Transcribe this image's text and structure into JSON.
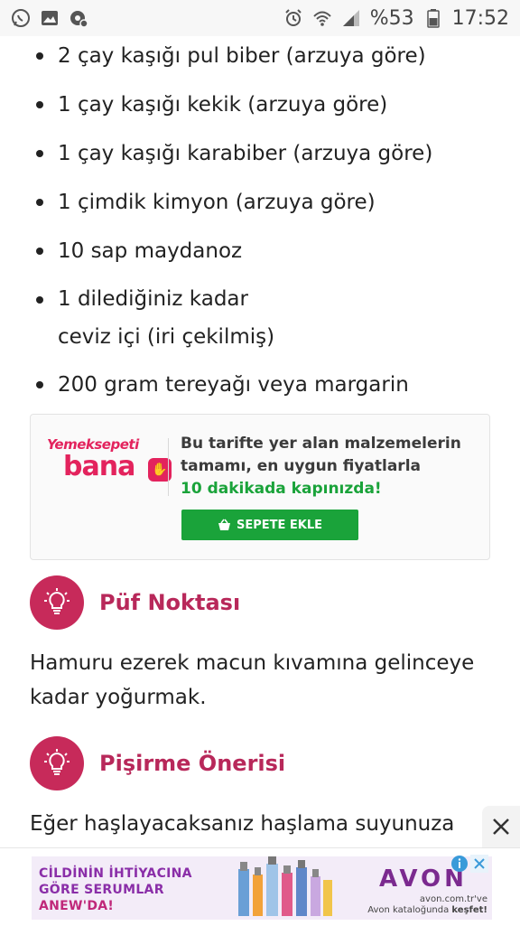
{
  "status_bar": {
    "battery_percent": "%53",
    "time": "17:52",
    "left_icons": [
      "whatsapp-icon",
      "gallery-icon",
      "settings-notification-icon"
    ],
    "right_icons": [
      "alarm-icon",
      "wifi-icon",
      "signal-icon",
      "battery-icon"
    ]
  },
  "ingredients": [
    "2 çay kaşığı pul biber (arzuya göre)",
    "1 çay kaşığı kekik (arzuya göre)",
    "1 çay kaşığı karabiber (arzuya göre)",
    "1 çimdik kimyon (arzuya göre)",
    "10 sap maydanoz",
    "1 dilediğiniz kadar\nceviz içi (iri çekilmiş)",
    "200 gram tereyağı veya margarin"
  ],
  "promo": {
    "logo_top": "Yemeksepeti",
    "logo_bottom": "bana",
    "text_line1": "Bu tarifte yer alan malzemelerin",
    "text_line2": "tamamı, en uygun fiyatlarla",
    "text_highlight": "10 dakikada kapınızda!",
    "button_label": "SEPETE EKLE",
    "accent_color": "#e3235d",
    "button_color": "#1aa33a"
  },
  "tips": [
    {
      "title": "Püf Noktası",
      "body": "Hamuru ezerek macun kıvamına gelinceye kadar yoğurmak."
    },
    {
      "title": "Pişirme Önerisi",
      "body": "Eğer haşlayacaksanız haşlama suyunuza"
    }
  ],
  "bottom_ad": {
    "headline_line1": "CİLDİNİN İHTİYACINA",
    "headline_line2": "GÖRE SERUMLAR",
    "headline_line3": "ANEW'DA!",
    "brand": "AVON",
    "site": "avon.com.tr",
    "site_suffix": "'ve",
    "tagline_prefix": "Avon kataloğunda",
    "tagline_bold": "keşfet!",
    "brand_color": "#7b2a8f"
  },
  "theme": {
    "tip_icon_color": "#c72a5a",
    "tip_title_color": "#b8285a"
  }
}
